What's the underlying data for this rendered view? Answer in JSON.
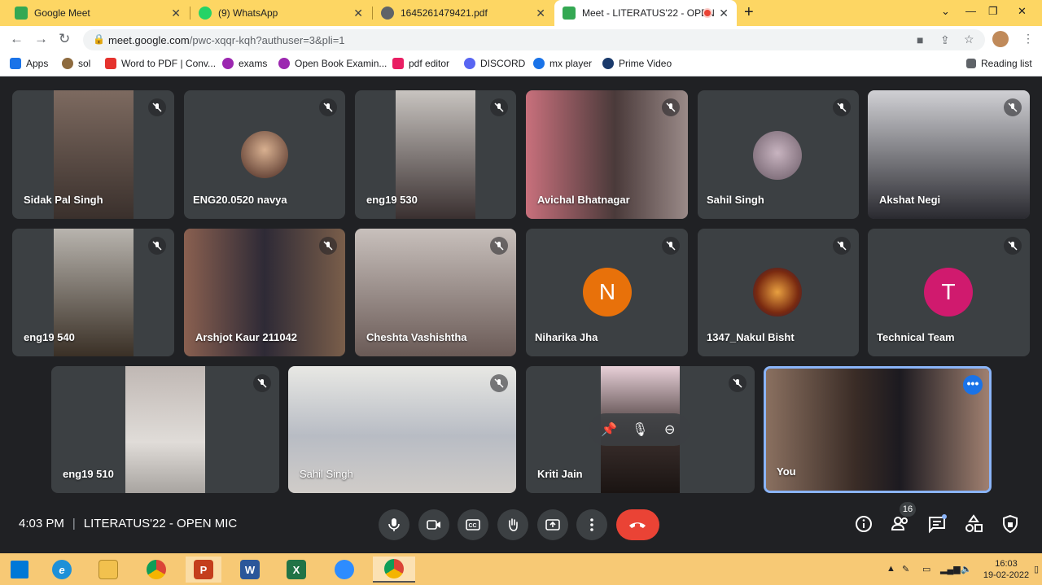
{
  "browser": {
    "tabs": [
      {
        "title": "Google Meet",
        "icon": "google-meet-icon",
        "color": "#34a853"
      },
      {
        "title": "(9) WhatsApp",
        "icon": "whatsapp-icon",
        "color": "#25d366"
      },
      {
        "title": "1645261479421.pdf",
        "icon": "globe-icon",
        "color": "#5f6368"
      },
      {
        "title": "Meet - LITERATUS'22 - OPEN",
        "icon": "google-meet-icon",
        "color": "#34a853"
      }
    ],
    "url": "meet.google.com",
    "url_path": "/pwc-xqqr-kqh?authuser=3&pli=1",
    "bookmarks": [
      {
        "label": "Apps",
        "icon": "apps-grid-icon",
        "color": "#1a73e8"
      },
      {
        "label": "sol",
        "icon": "globe-icon",
        "color": "#8e6b3f"
      },
      {
        "label": "Word to PDF | Conv...",
        "icon": "ilovepdf-icon",
        "color": "#e5322d"
      },
      {
        "label": "exams",
        "icon": "globe-icon",
        "color": "#9c27b0"
      },
      {
        "label": "Open Book Examin...",
        "icon": "globe-icon",
        "color": "#9c27b0"
      },
      {
        "label": "pdf editor",
        "icon": "pdf-editor-icon",
        "color": "#e91e63"
      },
      {
        "label": "DISCORD",
        "icon": "discord-icon",
        "color": "#5865f2"
      },
      {
        "label": "mx player",
        "icon": "play-icon",
        "color": "#1a73e8"
      },
      {
        "label": "Prime Video",
        "icon": "play-icon",
        "color": "#1a3a6b"
      }
    ],
    "reading_list": "Reading list"
  },
  "participants": [
    {
      "name": "Sidak Pal Singh",
      "type": "video",
      "color": "#6b5a55"
    },
    {
      "name": "ENG20.0520 navya",
      "type": "photo",
      "color": "#7a4a3a"
    },
    {
      "name": "eng19 530",
      "type": "video",
      "color": "#8a7f78"
    },
    {
      "name": "Avichal Bhatnagar",
      "type": "video",
      "color": "#b5606d"
    },
    {
      "name": "Sahil Singh",
      "type": "photo",
      "color": "#8a7a86"
    },
    {
      "name": "Akshat Negi",
      "type": "video",
      "color": "#9a9aa0"
    },
    {
      "name": "eng19 540",
      "type": "video",
      "color": "#5a5048"
    },
    {
      "name": "Arshjot Kaur 211042",
      "type": "video",
      "color": "#6b4a3f"
    },
    {
      "name": "Cheshta Vashishtha",
      "type": "video",
      "color": "#9a8a84"
    },
    {
      "name": "Niharika Jha",
      "type": "initial",
      "initial": "N",
      "color": "#e8710a"
    },
    {
      "name": "1347_Nakul Bisht",
      "type": "photo",
      "color": "#a0501a"
    },
    {
      "name": "Technical Team",
      "type": "initial",
      "initial": "T",
      "color": "#d01a6e"
    },
    {
      "name": "eng19 510",
      "type": "video",
      "color": "#b0a8a4"
    },
    {
      "name": "Sahil Singh",
      "type": "video",
      "color": "#d8d8d4"
    },
    {
      "name": "Kriti Jain",
      "type": "video",
      "color": "#3a2e2c"
    },
    {
      "name": "You",
      "type": "video",
      "color": "#6a5040"
    }
  ],
  "meeting": {
    "time": "4:03 PM",
    "title": "LITERATUS'22 - OPEN MIC",
    "participant_count": "16"
  },
  "taskbar": {
    "apps": [
      {
        "icon": "windows-start-icon",
        "color": "#0078d7",
        "label": ""
      },
      {
        "icon": "internet-explorer-icon",
        "color": "#1e90d8",
        "label": "e"
      },
      {
        "icon": "file-explorer-icon",
        "color": "#f2c14e",
        "label": ""
      },
      {
        "icon": "chrome-icon",
        "color": "#db4437",
        "label": ""
      },
      {
        "icon": "powerpoint-icon",
        "color": "#c43e1c",
        "label": "P"
      },
      {
        "icon": "word-icon",
        "color": "#2b579a",
        "label": "W"
      },
      {
        "icon": "excel-icon",
        "color": "#217346",
        "label": "X"
      },
      {
        "icon": "zoom-icon",
        "color": "#2d8cff",
        "label": ""
      },
      {
        "icon": "chrome-icon",
        "color": "#db4437",
        "label": ""
      }
    ],
    "time": "16:03",
    "date": "19-02-2022"
  }
}
